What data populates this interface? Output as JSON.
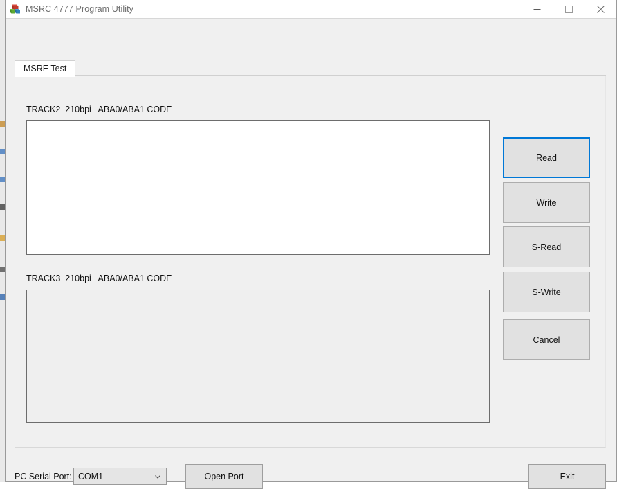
{
  "window": {
    "title": "MSRC 4777 Program Utility",
    "app_icon": "app-cubes-icon",
    "controls": {
      "minimize": "minimize-icon",
      "maximize": "maximize-icon",
      "close": "close-icon"
    },
    "title_color": "#6e6e6e",
    "background": "#f0f0f0"
  },
  "tabs": [
    {
      "label": "MSRE Test",
      "selected": true
    }
  ],
  "main": {
    "track2": {
      "label": "TRACK2  210bpi   ABA0/ABA1 CODE",
      "value": "",
      "placeholder": "",
      "enabled": true
    },
    "track3": {
      "label": "TRACK3  210bpi   ABA0/ABA1 CODE",
      "value": "",
      "placeholder": "",
      "enabled": false
    },
    "buttons": [
      {
        "label": "Read",
        "focused": true
      },
      {
        "label": "Write",
        "focused": false
      },
      {
        "label": "S-Read",
        "focused": false
      },
      {
        "label": "S-Write",
        "focused": false
      },
      {
        "label": "Cancel",
        "focused": false
      }
    ]
  },
  "footer": {
    "serial_label": "PC Serial Port:",
    "serial_value": "COM1",
    "serial_options": [
      "COM1"
    ],
    "dropdown_icon": "chevron-down-icon",
    "open_port_label": "Open Port",
    "exit_label": "Exit"
  },
  "colors": {
    "focus_accent": "#0078d7",
    "button_face": "#e1e1e1",
    "window_face": "#f0f0f0",
    "textbox_border": "#6d6d6d"
  }
}
